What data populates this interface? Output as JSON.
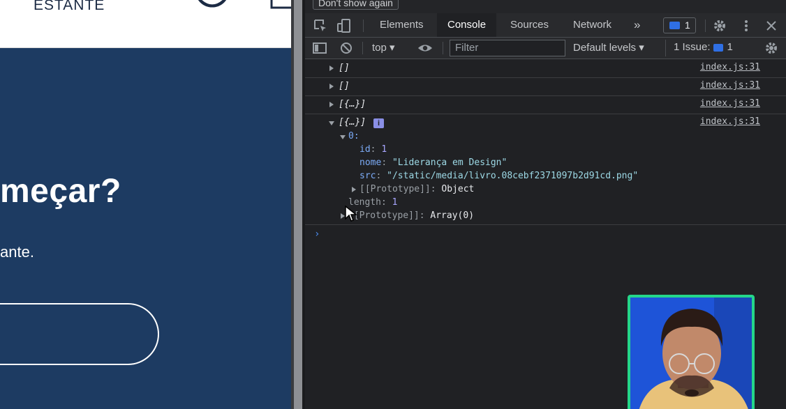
{
  "site": {
    "brand": "ESTANTE",
    "hero_title": "meçar?",
    "hero_subtitle": "ante.",
    "colors": {
      "hero_bg": "#1d3b62",
      "header_bg": "#ffffff"
    }
  },
  "devtools": {
    "infobar": {
      "dont_show_label": "Don't show again"
    },
    "tabs": [
      {
        "label": "Elements",
        "active": false
      },
      {
        "label": "Console",
        "active": true
      },
      {
        "label": "Sources",
        "active": false
      },
      {
        "label": "Network",
        "active": false
      }
    ],
    "more_tabs_label": "»",
    "messages_badge_count": "1",
    "toolbar": {
      "context": "top",
      "filter_placeholder": "Filter",
      "levels": "Default levels",
      "issues_label": "1 Issue:",
      "issues_count": "1"
    },
    "console": {
      "entries": [
        {
          "summary": "[]",
          "source": "index.js:31"
        },
        {
          "summary": "[]",
          "source": "index.js:31"
        },
        {
          "summary": "[{…}]",
          "source": "index.js:31"
        },
        {
          "summary": "[{…}]",
          "source": "index.js:31",
          "expanded": true
        }
      ],
      "expanded": {
        "index_label": "0:",
        "id_key": "id",
        "id_value": "1",
        "nome_key": "nome",
        "nome_value": "\"Liderança em Design\"",
        "src_key": "src",
        "src_value": "\"/static/media/livro.08cebf2371097b2d91cd.png\"",
        "proto_key": "[[Prototype]]",
        "proto_value": "Object",
        "length_key": "length",
        "length_value": "1",
        "array_proto_key": "[[Prototype]]",
        "array_proto_value": "Array(0)"
      },
      "prompt_symbol": "›"
    }
  }
}
